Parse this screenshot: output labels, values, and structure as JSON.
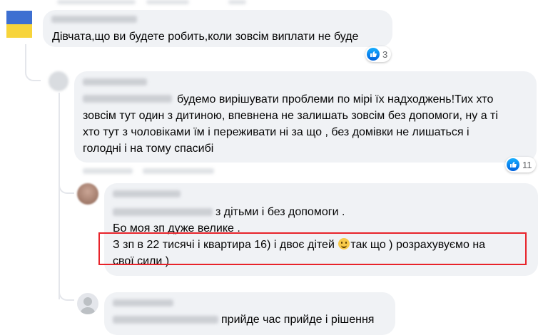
{
  "comments": [
    {
      "text": "Дівчата,що ви будете робить,коли зовсім виплати не буде",
      "reaction": {
        "icon": "like-icon",
        "count": "3"
      }
    },
    {
      "lines": [
        "будемо вирішувати проблеми по мірі їх надходжень!Тих хто",
        "зовсім тут один з дитиною, впевнена не залишать зовсім без допомоги, ну а ті",
        "хто тут з чоловіками їм і переживати ні за що , без домівки не лишаться і",
        "голодні і на тому спасибі"
      ],
      "reaction": {
        "icon": "like-icon",
        "count": "11"
      }
    },
    {
      "lines": [
        "з дітьми і без допомоги .",
        "Бо моя зп дуже велике .",
        "З зп в 22 тисячі і квартира 16) і двоє дітей",
        "так що ) розрахувуємо на",
        "свої сили )"
      ],
      "highlight_color": "#e8232a"
    },
    {
      "text": "прийде час прийде і рішення"
    }
  ]
}
